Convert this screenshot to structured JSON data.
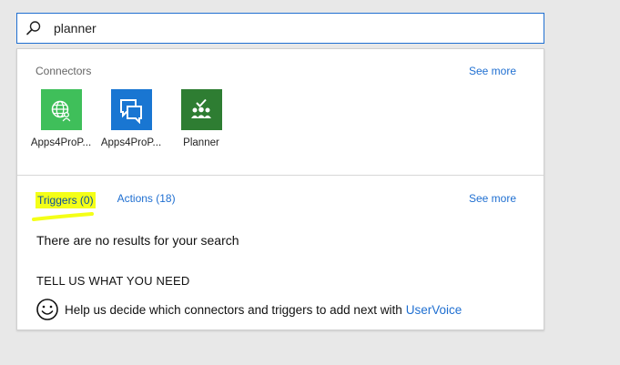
{
  "search": {
    "value": "planner",
    "icon": "search-icon"
  },
  "connectors": {
    "title": "Connectors",
    "see_more": "See more",
    "items": [
      {
        "label": "Apps4ProP...",
        "icon": "globe-person-icon",
        "color": "#3fbf5a"
      },
      {
        "label": "Apps4ProP...",
        "icon": "chat-bubbles-icon",
        "color": "#1976d2"
      },
      {
        "label": "Planner",
        "icon": "planner-people-check-icon",
        "color": "#2e7d32"
      }
    ]
  },
  "results": {
    "tabs": [
      {
        "label": "Triggers (0)",
        "active": true
      },
      {
        "label": "Actions (18)",
        "active": false
      }
    ],
    "see_more": "See more",
    "no_results": "There are no results for your search",
    "tell_us": "TELL US WHAT YOU NEED",
    "help_text": "Help us decide which connectors and triggers to add next with",
    "link_text": "UserVoice"
  },
  "colors": {
    "accent": "#1f6fd1",
    "highlight": "#f4ff17"
  }
}
